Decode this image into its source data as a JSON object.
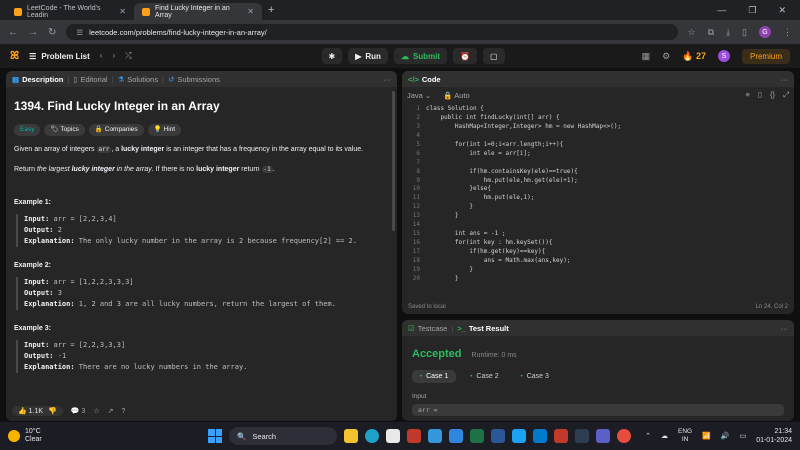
{
  "browser": {
    "tabs": [
      {
        "title": "LeetCode - The World's Leadin",
        "active": false
      },
      {
        "title": "Find Lucky Integer in an Array",
        "active": true
      }
    ],
    "url": "leetcode.com/problems/find-lucky-integer-in-an-array/",
    "profile_initial": "G"
  },
  "lcnav": {
    "problem_list": "Problem List",
    "run": "Run",
    "submit": "Submit",
    "streak": "27",
    "avatar_initial": "S",
    "premium": "Premium"
  },
  "left_tabs": {
    "description": "Description",
    "editorial": "Editorial",
    "solutions": "Solutions",
    "submissions": "Submissions"
  },
  "problem": {
    "title": "1394. Find Lucky Integer in an Array",
    "chips": {
      "difficulty": "Easy",
      "topics": "Topics",
      "companies": "Companies",
      "hint": "Hint"
    },
    "p1_a": "Given an array of integers ",
    "p1_code": "arr",
    "p1_b": ", a ",
    "p1_bold": "lucky integer",
    "p1_c": " is an integer that has a frequency in the array equal to its value.",
    "p2_a": "Return ",
    "p2_i1": "the largest ",
    "p2_bold": "lucky integer",
    "p2_i2": " in the array",
    "p2_b": ". If there is no ",
    "p2_bold2": "lucky integer",
    "p2_c": " return ",
    "p2_code": "-1",
    "p2_d": ".",
    "examples": [
      {
        "title": "Example 1:",
        "input": "arr = [2,2,3,4]",
        "output": "2",
        "explanation": "The only lucky number in the array is 2 because frequency[2] == 2."
      },
      {
        "title": "Example 2:",
        "input": "arr = [1,2,2,3,3,3]",
        "output": "3",
        "explanation": "1, 2 and 3 are all lucky numbers, return the largest of them."
      },
      {
        "title": "Example 3:",
        "input": "arr = [2,2,3,3,3]",
        "output": "-1",
        "explanation": "There are no lucky numbers in the array."
      }
    ],
    "labels": {
      "input": "Input:",
      "output": "Output:",
      "explanation": "Explanation:"
    },
    "likes": "1.1K",
    "comments": "3"
  },
  "editor": {
    "tab": "Code",
    "language": "Java",
    "mode": "Auto",
    "status": "Saved to local",
    "cursor": "Ln 24, Col 2",
    "lines": [
      "class Solution {",
      "    public int findLucky(int[] arr) {",
      "        HashMap<Integer,Integer> hm = new HashMap<>();",
      "",
      "        for(int i=0;i<arr.length;i++){",
      "            int ele = arr[i];",
      "",
      "            if(hm.containsKey(ele)==true){",
      "                hm.put(ele,hm.get(ele)+1);",
      "            }else{",
      "                hm.put(ele,1);",
      "            }",
      "        }",
      "",
      "        int ans = -1 ;",
      "        for(int key : hm.keySet()){",
      "            if(hm.get(key)==key){",
      "                ans = Math.max(ans,key);",
      "            }",
      "        }"
    ]
  },
  "result": {
    "tab_testcase": "Testcase",
    "tab_result": "Test Result",
    "verdict": "Accepted",
    "runtime": "Runtime: 0 ms",
    "cases": [
      "Case 1",
      "Case 2",
      "Case 3"
    ],
    "input_label": "Input",
    "input_value": "arr ="
  },
  "taskbar": {
    "temp": "10°C",
    "weather": "Clear",
    "search": "Search",
    "lang1": "ENG",
    "lang2": "IN",
    "time": "21:34",
    "date": "01-01-2024"
  }
}
